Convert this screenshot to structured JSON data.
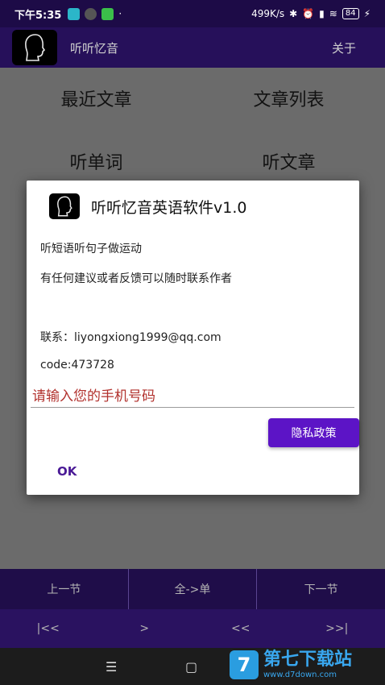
{
  "status_bar": {
    "time": "下午5:35",
    "net_speed": "499K/s",
    "battery": "84",
    "icons": [
      "shield-icon",
      "signal-app-icon",
      "wechat-icon",
      "dot-icon",
      "bluetooth-icon",
      "alarm-icon",
      "cell-signal-icon",
      "wifi-icon",
      "battery-icon",
      "charging-icon"
    ]
  },
  "app_bar": {
    "title": "听听忆音",
    "about": "关于"
  },
  "main_menu": {
    "recent": "最近文章",
    "list": "文章列表",
    "words": "听单词",
    "articles": "听文章"
  },
  "dialog": {
    "title": "听听忆音英语软件v1.0",
    "line1": "听短语听句子做运动",
    "line2": "有任何建议或者反馈可以随时联系作者",
    "contact": "联系：liyongxiong1999@qq.com",
    "code": "code:473728",
    "phone_placeholder": "请输入您的手机号码",
    "phone_value": "",
    "privacy_button": "隐私政策",
    "ok_button": "OK"
  },
  "controls": {
    "prev": "上一节",
    "mode": "全->单",
    "next": "下一节",
    "first": "|<<",
    "play": ">",
    "rewind": "<<",
    "last": ">>|"
  },
  "nav": {
    "menu_glyph": "☰",
    "home_glyph": "▢"
  },
  "watermark": {
    "text": "第七下载站",
    "url": "www.d7down.com",
    "logo_char": "7"
  },
  "colors": {
    "primary_dark": "#1d0b47",
    "primary": "#5c14c6",
    "accent_text": "#4a1a96",
    "hint_red": "#b2322e",
    "watermark_blue": "#39a7ef"
  }
}
